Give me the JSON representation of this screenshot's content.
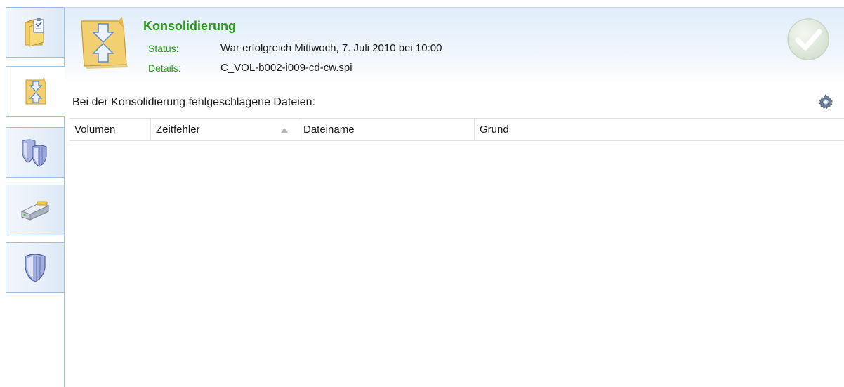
{
  "sidebar": {
    "tabs": [
      {
        "name": "sidebar-tab-overview",
        "icon": "folder-clipboard-icon",
        "active": false
      },
      {
        "name": "sidebar-tab-consolidation",
        "icon": "folder-arrows-icon",
        "active": true
      },
      {
        "name": "sidebar-tab-protection-multi",
        "icon": "double-shield-icon",
        "active": false
      },
      {
        "name": "sidebar-tab-drive",
        "icon": "hard-drive-icon",
        "active": false
      },
      {
        "name": "sidebar-tab-protection",
        "icon": "shield-icon",
        "active": false
      }
    ]
  },
  "header": {
    "title": "Konsolidierung",
    "status_label": "Status:",
    "status_value": "War erfolgreich Mittwoch, 7. Juli 2010 bei 10:00",
    "details_label": "Details:",
    "details_value": "C_VOL-b002-i009-cd-cw.spi",
    "icon": "folder-arrows-icon",
    "badge_icon": "success-check-icon"
  },
  "section": {
    "title": "Bei der Konsolidierung fehlgeschlagene Dateien:",
    "settings_icon": "gear-icon"
  },
  "table": {
    "columns": [
      "Volumen",
      "Zeitfehler",
      "Dateiname",
      "Grund"
    ],
    "sorted_column": "Zeitfehler",
    "sort_direction": "ascending",
    "rows": []
  },
  "colors": {
    "title_green": "#2a9a16",
    "header_blue": "#e0edf9",
    "divider_blue": "#9fc3e6"
  }
}
